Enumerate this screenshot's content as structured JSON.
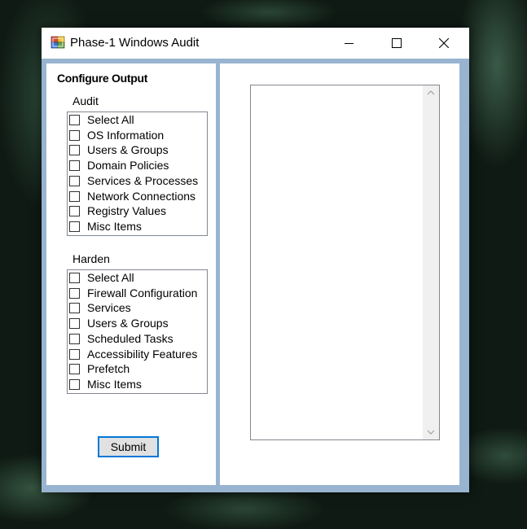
{
  "window": {
    "title": "Phase-1 Windows Audit",
    "controls": [
      "minimize",
      "maximize",
      "close"
    ]
  },
  "config": {
    "heading": "Configure Output",
    "audit": {
      "label": "Audit",
      "items": [
        {
          "label": "Select All",
          "checked": false
        },
        {
          "label": "OS Information",
          "checked": false
        },
        {
          "label": "Users & Groups",
          "checked": false
        },
        {
          "label": "Domain Policies",
          "checked": false
        },
        {
          "label": "Services & Processes",
          "checked": false
        },
        {
          "label": "Network Connections",
          "checked": false
        },
        {
          "label": "Registry Values",
          "checked": false
        },
        {
          "label": "Misc Items",
          "checked": false
        }
      ]
    },
    "harden": {
      "label": "Harden",
      "items": [
        {
          "label": "Select All",
          "checked": false
        },
        {
          "label": "Firewall Configuration",
          "checked": false
        },
        {
          "label": "Services",
          "checked": false
        },
        {
          "label": "Users & Groups",
          "checked": false
        },
        {
          "label": "Scheduled Tasks",
          "checked": false
        },
        {
          "label": "Accessibility Features",
          "checked": false
        },
        {
          "label": "Prefetch",
          "checked": false
        },
        {
          "label": "Misc Items",
          "checked": false
        }
      ]
    },
    "submit_label": "Submit"
  },
  "output": {
    "text": ""
  },
  "colors": {
    "client_bg": "#99b4d1",
    "focus_border": "#0078d7"
  }
}
